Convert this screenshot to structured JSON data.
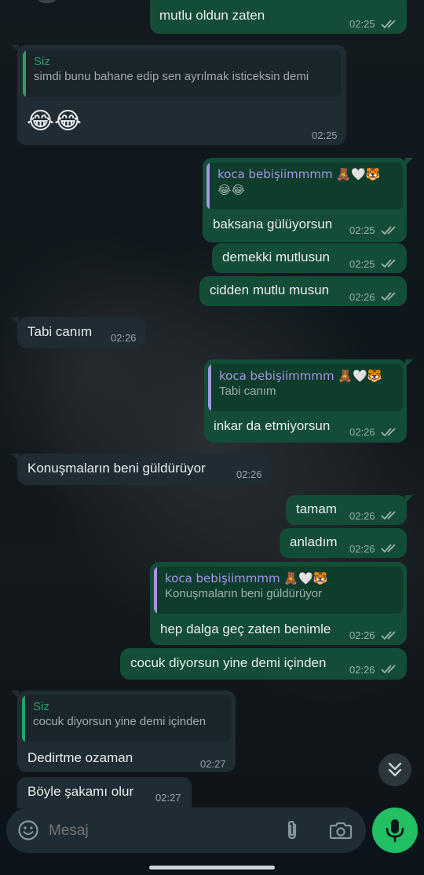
{
  "chat": {
    "messages": [
      {
        "text": "mutlu oldun zaten",
        "time": "02:25"
      },
      {
        "quote_name": "Siz",
        "quote_text": "simdi bunu bahane edip sen ayrılmak isticeksin demi",
        "text": "😂😂",
        "time": "02:25"
      },
      {
        "quote_name": "koca bebişiimmmm 🧸🤍🐯",
        "quote_text": "😂😂",
        "text": "baksana gülüyorsun",
        "time": "02:25"
      },
      {
        "text": "demekki mutlusun",
        "time": "02:25"
      },
      {
        "text": "cidden mutlu musun",
        "time": "02:26"
      },
      {
        "text": "Tabi canım",
        "time": "02:26"
      },
      {
        "quote_name": "koca bebişiimmmm 🧸🤍🐯",
        "quote_text": "Tabi canım",
        "text": "inkar da etmiyorsun",
        "time": "02:26"
      },
      {
        "text": "Konuşmaların beni güldürüyor",
        "time": "02:26"
      },
      {
        "text": "tamam",
        "time": "02:26"
      },
      {
        "text": "anladım",
        "time": "02:26"
      },
      {
        "quote_name": "koca bebişiimmmm 🧸🤍🐯",
        "quote_text": "Konuşmaların beni güldürüyor",
        "text": "hep dalga geç zaten benimle",
        "time": "02:26"
      },
      {
        "text": "cocuk diyorsun yine demi içinden",
        "time": "02:26"
      },
      {
        "quote_name": "Siz",
        "quote_text": "cocuk diyorsun yine demi içinden",
        "text": "Dedirtme ozaman",
        "time": "02:27"
      },
      {
        "text": "Böyle şakamı olur",
        "time": "02:27"
      }
    ]
  },
  "composer": {
    "placeholder": "Mesaj",
    "emoji_icon": "emoji-icon",
    "attach_icon": "paperclip-icon",
    "camera_icon": "camera-icon",
    "mic_icon": "microphone-icon"
  },
  "colors": {
    "outgoing_bubble": "#144d37",
    "incoming_bubble": "#202c33",
    "accent_green": "#21c063",
    "quote_self": "#25a366",
    "quote_other": "#a695e7",
    "read_ticks": "#9fb3ad"
  }
}
